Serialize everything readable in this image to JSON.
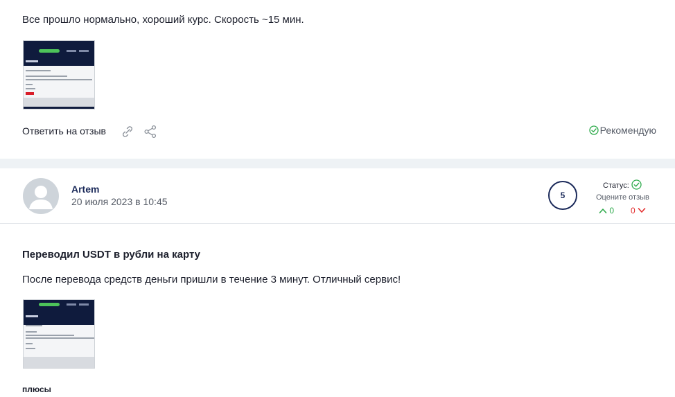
{
  "review1": {
    "text": "Все прошло нормально, хороший курс. Скорость ~15 мин.",
    "reply_label": "Ответить на отзыв",
    "recommend_label": "Рекомендую",
    "link_icon": "link-icon",
    "share_icon": "share-icon"
  },
  "review2": {
    "author": "Artem",
    "date": "20 июля 2023 в 10:45",
    "rating": "5",
    "status_label": "Статус:",
    "rate_label": "Оцените отзыв",
    "upvotes": "0",
    "downvotes": "0",
    "title": "Переводил USDT в рубли на карту",
    "text": "После перевода средств деньги пришли в течение 3 минут. Отличный сервис!",
    "pros_label": "плюсы"
  },
  "colors": {
    "accent": "#1b2a5a",
    "positive": "#2eaa4b",
    "negative": "#e32b2b"
  }
}
